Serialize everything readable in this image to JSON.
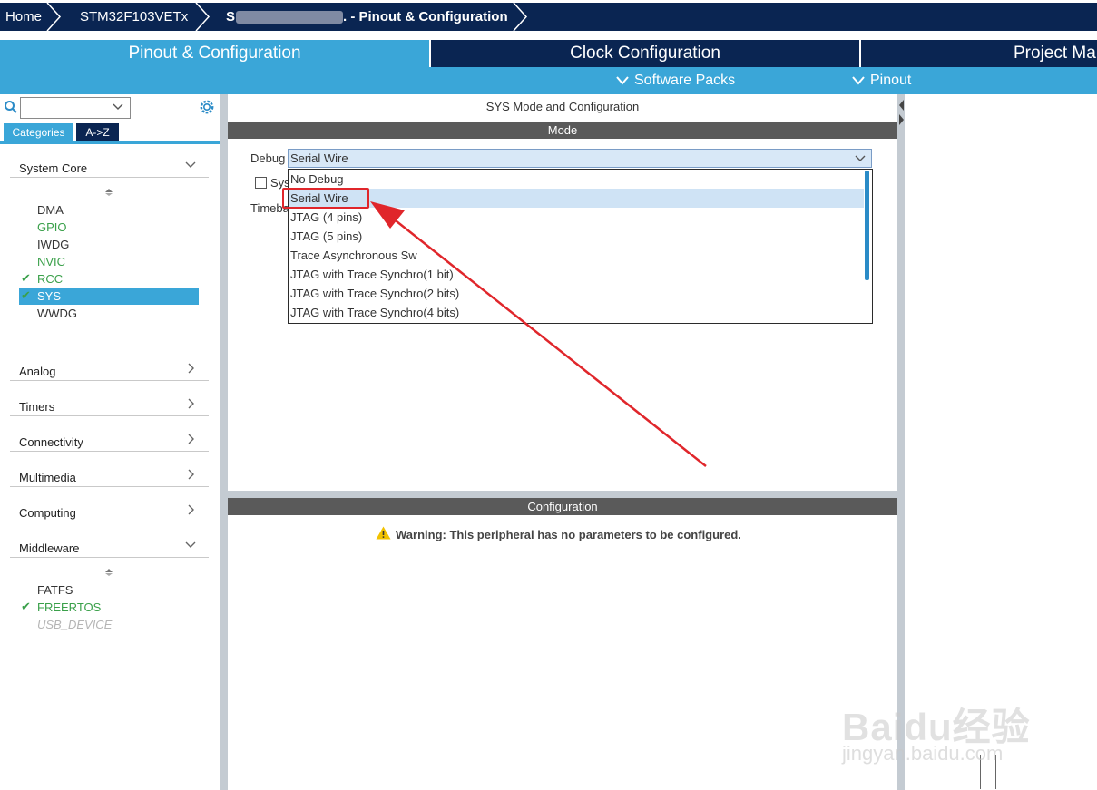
{
  "breadcrumb": {
    "home": "Home",
    "device": "STM32F103VETx",
    "project_visible_start": "S",
    "project_visible_end": ". - Pinout & Configuration"
  },
  "tabs": [
    {
      "label": "Pinout & Configuration",
      "active": true
    },
    {
      "label": "Clock Configuration",
      "active": false
    },
    {
      "label": "Project Mar",
      "active": false
    }
  ],
  "subbar": {
    "software_packs": "Software Packs",
    "pinout": "Pinout"
  },
  "left": {
    "search_placeholder": "",
    "tab_categories": "Categories",
    "tab_az": "A->Z",
    "system_core": {
      "label": "System Core",
      "items": [
        "DMA",
        "GPIO",
        "IWDG",
        "NVIC",
        "RCC",
        "SYS",
        "WWDG"
      ]
    },
    "categories": [
      "Analog",
      "Timers",
      "Connectivity",
      "Multimedia",
      "Computing"
    ],
    "middleware": {
      "label": "Middleware",
      "items": [
        "FATFS",
        "FREERTOS",
        "USB_DEVICE"
      ]
    }
  },
  "mode_panel": {
    "title": "SYS Mode and Configuration",
    "section": "Mode",
    "debug_label": "Debug",
    "debug_value": "Serial Wire",
    "sys_checkbox_label_partial": "Sys",
    "timebase_label_partial": "Timeba",
    "options": [
      "No Debug",
      "Serial Wire",
      "JTAG (4 pins)",
      "JTAG (5 pins)",
      "Trace Asynchronous Sw",
      "JTAG with Trace Synchro(1 bit)",
      "JTAG with Trace Synchro(2 bits)",
      "JTAG with Trace Synchro(4 bits)"
    ],
    "selected_option": "Serial Wire"
  },
  "config_panel": {
    "section": "Configuration",
    "warning": "Warning: This peripheral has no parameters to be configured."
  },
  "watermark": {
    "line1": "Bai",
    "line1b": "du",
    "line1c": "经验",
    "line2": "jingyan.baidu.com"
  },
  "colors": {
    "navy": "#0a2552",
    "blue": "#3aa6d8",
    "green": "#3aa04a",
    "highlight": "#cfe3f5",
    "annotation_red": "#e0262b"
  }
}
